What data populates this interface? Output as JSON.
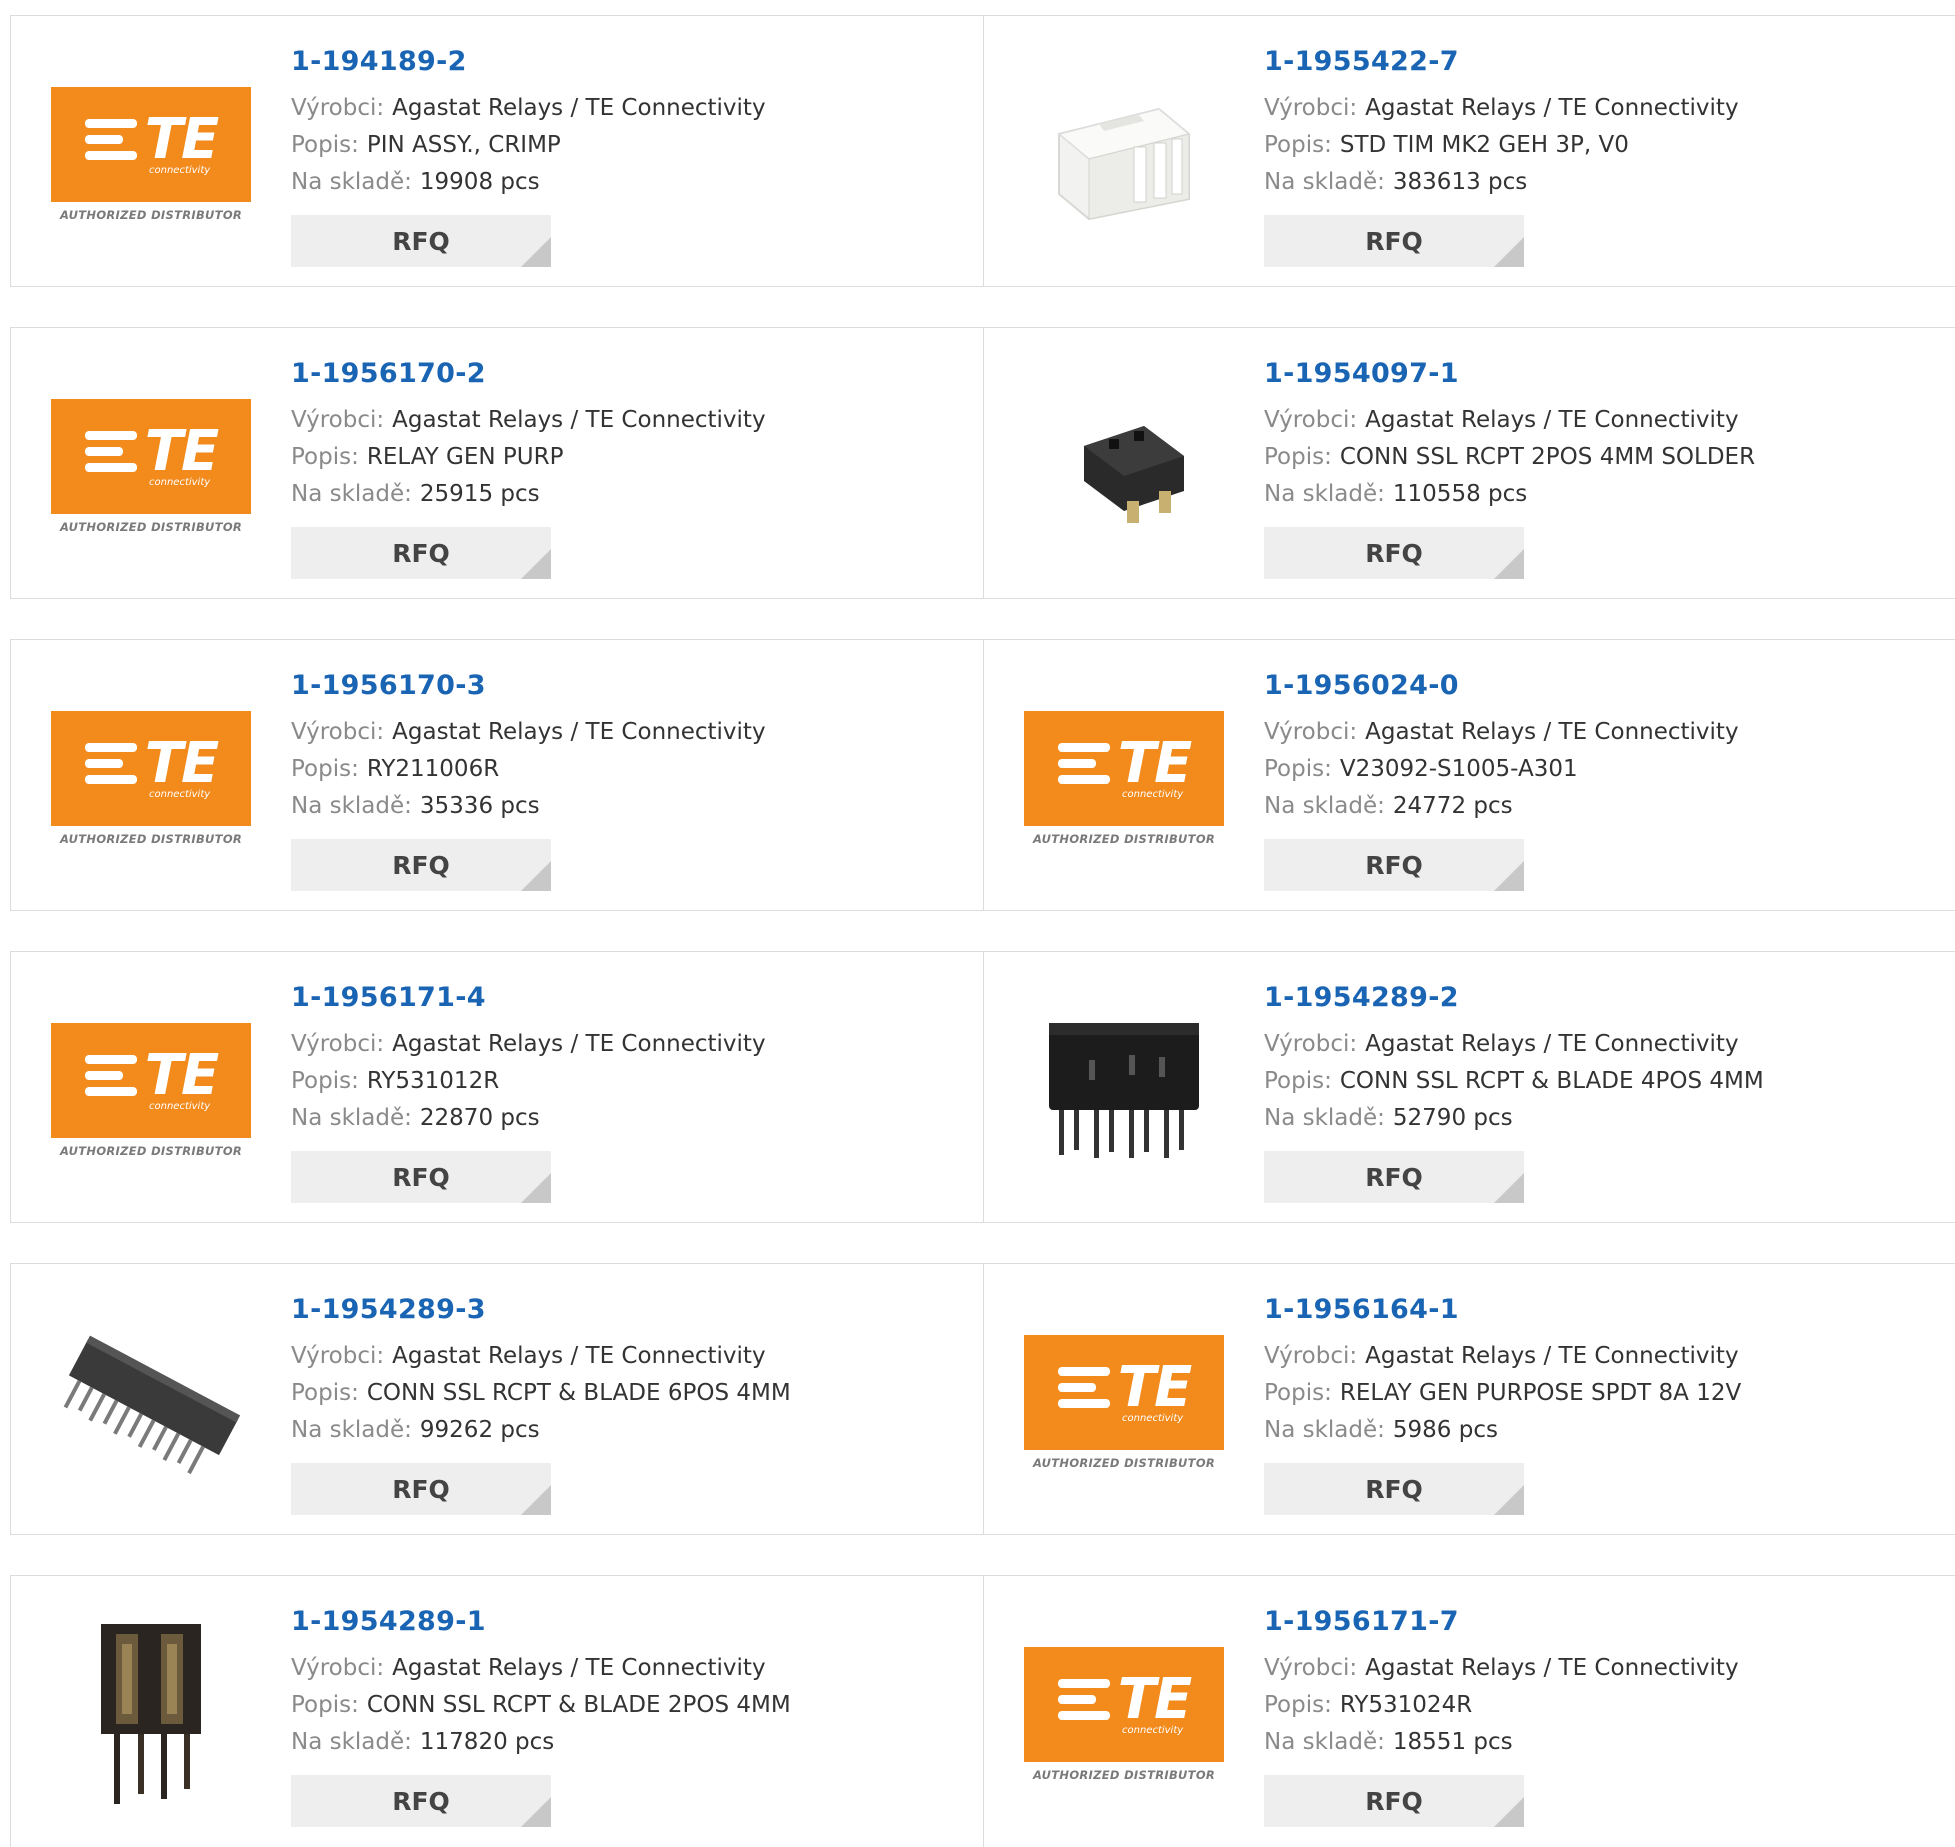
{
  "labels": {
    "manufacturer": "Výrobci:",
    "description": "Popis:",
    "stock": "Na skladě:",
    "rfq": "RFQ"
  },
  "logo": {
    "brand": "TE",
    "sub": "connectivity",
    "tagline": "AUTHORIZED DISTRIBUTOR",
    "color": "#f28a1c"
  },
  "products": [
    {
      "part": "1-194189-2",
      "manufacturer": "Agastat Relays / TE Connectivity",
      "description": "PIN ASSY., CRIMP",
      "stock": "19908 pcs",
      "image": "te-logo"
    },
    {
      "part": "1-1955422-7",
      "manufacturer": "Agastat Relays / TE Connectivity",
      "description": "STD TIM MK2 GEH 3P, V0",
      "stock": "383613 pcs",
      "image": "white-housing-photo"
    },
    {
      "part": "1-1956170-2",
      "manufacturer": "Agastat Relays / TE Connectivity",
      "description": "RELAY GEN PURP",
      "stock": "25915 pcs",
      "image": "te-logo"
    },
    {
      "part": "1-1954097-1",
      "manufacturer": "Agastat Relays / TE Connectivity",
      "description": "CONN SSL RCPT 2POS 4MM SOLDER",
      "stock": "110558 pcs",
      "image": "black-connector-photo"
    },
    {
      "part": "1-1956170-3",
      "manufacturer": "Agastat Relays / TE Connectivity",
      "description": "RY211006R",
      "stock": "35336 pcs",
      "image": "te-logo"
    },
    {
      "part": "1-1956024-0",
      "manufacturer": "Agastat Relays / TE Connectivity",
      "description": "V23092-S1005-A301",
      "stock": "24772 pcs",
      "image": "te-logo"
    },
    {
      "part": "1-1956171-4",
      "manufacturer": "Agastat Relays / TE Connectivity",
      "description": "RY531012R",
      "stock": "22870 pcs",
      "image": "te-logo"
    },
    {
      "part": "1-1954289-2",
      "manufacturer": "Agastat Relays / TE Connectivity",
      "description": "CONN SSL RCPT & BLADE 4POS 4MM",
      "stock": "52790 pcs",
      "image": "4pos-connector-photo"
    },
    {
      "part": "1-1954289-3",
      "manufacturer": "Agastat Relays / TE Connectivity",
      "description": "CONN SSL RCPT & BLADE 6POS 4MM",
      "stock": "99262 pcs",
      "image": "6pos-connector-photo"
    },
    {
      "part": "1-1956164-1",
      "manufacturer": "Agastat Relays / TE Connectivity",
      "description": "RELAY GEN PURPOSE SPDT 8A 12V",
      "stock": "5986 pcs",
      "image": "te-logo"
    },
    {
      "part": "1-1954289-1",
      "manufacturer": "Agastat Relays / TE Connectivity",
      "description": "CONN SSL RCPT & BLADE 2POS 4MM",
      "stock": "117820 pcs",
      "image": "2pos-connector-photo"
    },
    {
      "part": "1-1956171-7",
      "manufacturer": "Agastat Relays / TE Connectivity",
      "description": "RY531024R",
      "stock": "18551 pcs",
      "image": "te-logo"
    }
  ]
}
